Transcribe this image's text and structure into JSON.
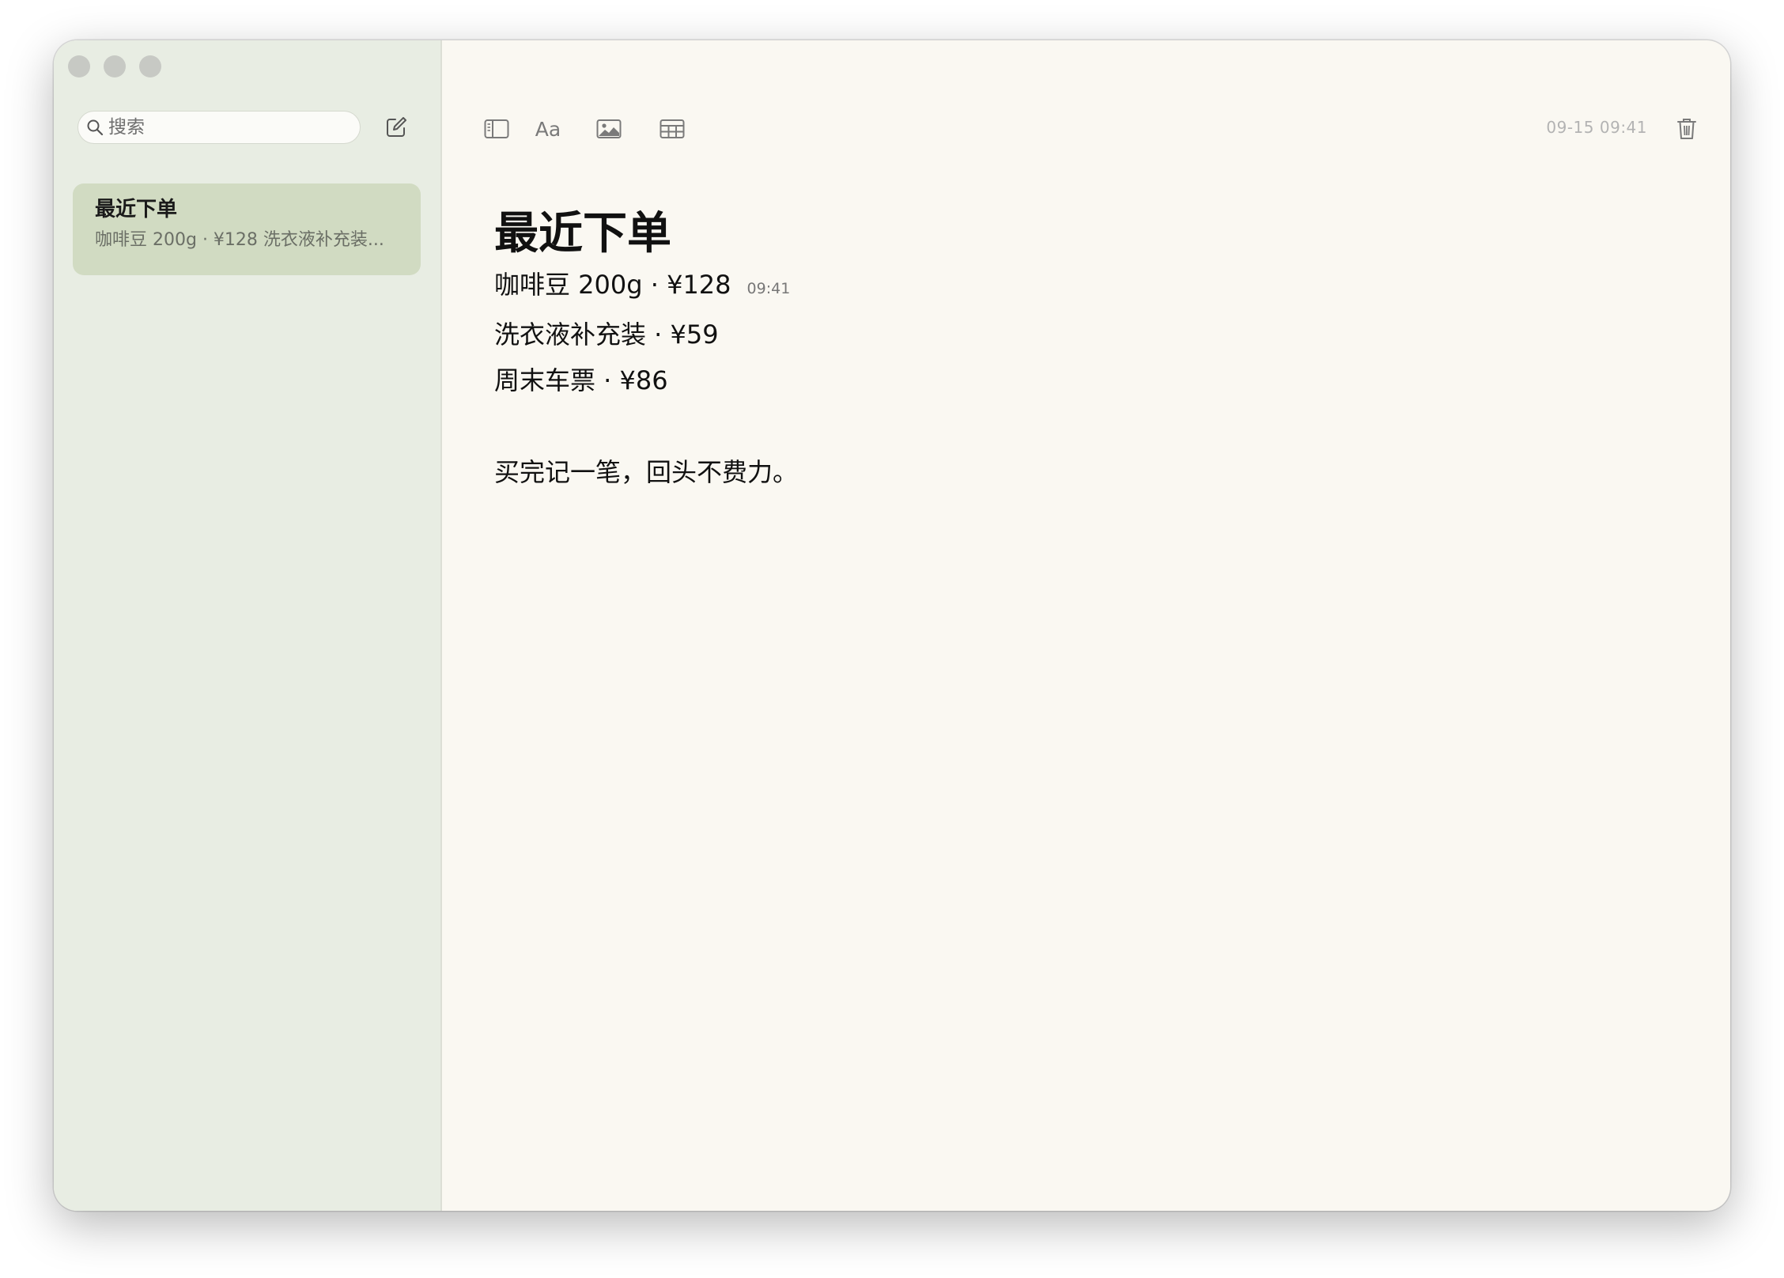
{
  "sidebar": {
    "search_placeholder": "搜索",
    "notes": [
      {
        "title": "最近下单",
        "preview": "咖啡豆 200g · ¥128 洗衣液补充装..."
      }
    ]
  },
  "toolbar": {
    "format_label": "Aa",
    "timestamp": "09-15 09:41"
  },
  "note": {
    "title": "最近下单",
    "lines": [
      {
        "text": "咖啡豆 200g · ¥128",
        "time": "09:41"
      },
      {
        "text": "洗衣液补充装 · ¥59"
      },
      {
        "text": "周末车票 · ¥86"
      }
    ],
    "footer": "买完记一笔，回头不费力。"
  },
  "colors": {
    "sidebar_bg": "#e8ede3",
    "selected_note": "#d1dbc2",
    "editor_bg": "#faf8f2",
    "traffic_light": "#c7c9c4"
  }
}
